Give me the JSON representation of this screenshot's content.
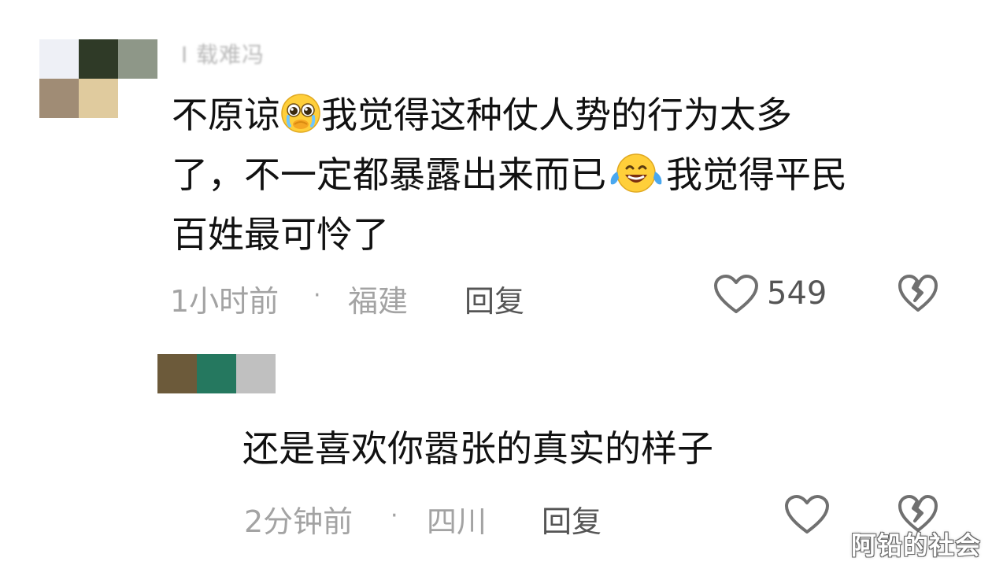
{
  "comments": [
    {
      "username": "I 载难冯",
      "text_segments": [
        "不原谅",
        "我觉得这种仗人势的行为太多",
        "了，不一定都暴露出来而已",
        "我觉得平民",
        "百姓最可怜了"
      ],
      "emoji_icons": [
        "pleading-crying-emoji",
        "tears-of-joy-emoji"
      ],
      "time": "1小时前",
      "separator": "·",
      "location": "福建",
      "reply_label": "回复",
      "like_count": "549"
    },
    {
      "text": "还是喜欢你嚣张的真实的样子",
      "time": "2分钟前",
      "separator": "·",
      "location": "四川",
      "reply_label": "回复",
      "like_count": ""
    }
  ],
  "watermark": "阿铅的社会",
  "colors": {
    "text": "#111111",
    "meta": "#a3a3a3",
    "action": "#555555",
    "icon_stroke": "#707070",
    "avatar1_tiles": [
      "#eef0f6",
      "#2f3a27",
      "#8e9788",
      "#a08c75",
      "#e0cb9e"
    ],
    "avatar2_tiles": [
      "#6c5a3a",
      "#25785f",
      "#c0c0c0"
    ]
  }
}
